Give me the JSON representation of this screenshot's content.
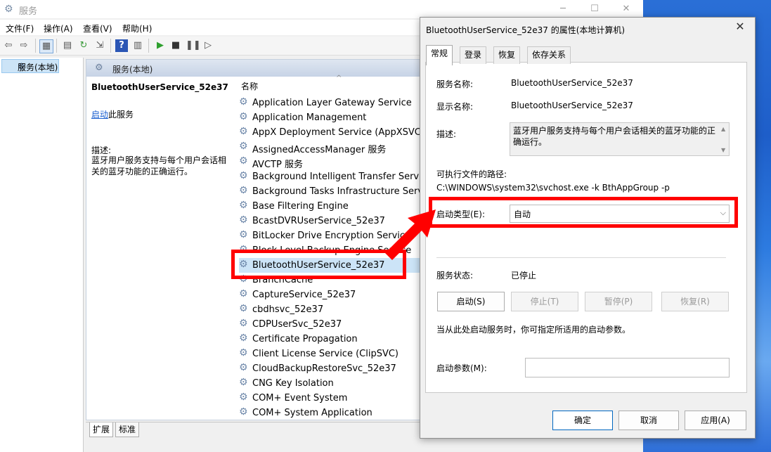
{
  "window": {
    "title": "服务"
  },
  "menu": [
    "文件(F)",
    "操作(A)",
    "查看(V)",
    "帮助(H)"
  ],
  "tree": {
    "item": "服务(本地)"
  },
  "panel": {
    "header": "服务(本地)",
    "selected_title": "BluetoothUserService_52e37",
    "start_link": "启动",
    "start_rest": "此服务",
    "desc_label": "描述:",
    "desc_text": "蓝牙用户服务支持与每个用户会话相关的蓝牙功能的正确运行。",
    "column_name": "名称",
    "services": [
      "Application Layer Gateway Service",
      "Application Management",
      "AppX Deployment Service (AppXSVC)",
      "AssignedAccessManager 服务",
      "AVCTP 服务",
      "Background Intelligent Transfer Service",
      "Background Tasks Infrastructure Service",
      "Base Filtering Engine",
      "BcastDVRUserService_52e37",
      "BitLocker Drive Encryption Service",
      "Block Level Backup Engine Service",
      "BluetoothUserService_52e37",
      "BranchCache",
      "CaptureService_52e37",
      "cbdhsvc_52e37",
      "CDPUserSvc_52e37",
      "Certificate Propagation",
      "Client License Service (ClipSVC)",
      "CloudBackupRestoreSvc_52e37",
      "CNG Key Isolation",
      "COM+ Event System",
      "COM+ System Application"
    ],
    "selected_service": "BluetoothUserService_52e37",
    "bottom_tabs": [
      "扩展",
      "标准"
    ]
  },
  "dialog": {
    "title": "BluetoothUserService_52e37 的属性(本地计算机)",
    "tabs": [
      "常规",
      "登录",
      "恢复",
      "依存关系"
    ],
    "service_name_label": "服务名称:",
    "service_name": "BluetoothUserService_52e37",
    "display_name_label": "显示名称:",
    "display_name": "BluetoothUserService_52e37",
    "desc_label": "描述:",
    "desc_text": "蓝牙用户服务支持与每个用户会话相关的蓝牙功能的正确运行。",
    "path_label": "可执行文件的路径:",
    "path": "C:\\WINDOWS\\system32\\svchost.exe -k BthAppGroup -p",
    "startup_type_label": "启动类型(E):",
    "startup_type": "自动",
    "status_label": "服务状态:",
    "status": "已停止",
    "buttons": {
      "start": "启动(S)",
      "stop": "停止(T)",
      "pause": "暂停(P)",
      "resume": "恢复(R)"
    },
    "hint": "当从此处启动服务时，你可指定所适用的启动参数。",
    "params_label": "启动参数(M):",
    "ok": "确定",
    "cancel": "取消",
    "apply": "应用(A)"
  },
  "colors": {
    "annotation": "#ff0000",
    "selection": "#cce4f7",
    "link": "#1a5fd0"
  }
}
